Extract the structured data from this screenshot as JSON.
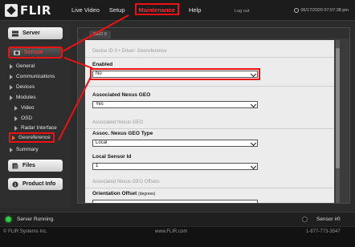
{
  "header": {
    "logo_text": "FLIR",
    "nav": [
      "Live Video",
      "Setup",
      "Maintenance",
      "Help"
    ],
    "logout": "Log out",
    "datetime": "06/17/2020 07:07:38 pm"
  },
  "sidebar": {
    "server": "Server",
    "sensor": "Sensor",
    "items": [
      "General",
      "Communications",
      "Devices",
      "Modules",
      "Video",
      "OSD",
      "Radar Interface",
      "Georeference",
      "Summary"
    ],
    "files": "Files",
    "product_info": "Product Info"
  },
  "panel": {
    "tab": "GEO 0",
    "section1": "Device ID 0  •  Driver: Georeference",
    "enabled_label": "Enabled",
    "enabled_value": "No",
    "assoc_geo_label": "Associated Nexus GEO",
    "assoc_geo_value": "Yes",
    "section2": "Associated Nexus GEO",
    "type_label": "Assoc. Nexus GEO Type",
    "type_value": "Local",
    "sensor_id_label": "Local Sensor Id",
    "sensor_id_value": "1",
    "section3": "Associated Nexus GEO Offsets",
    "orientation_label": "Orientation Offset",
    "orientation_unit": "(degrees)"
  },
  "status": {
    "server": "Server Running.",
    "sensor": "Sensor #0"
  },
  "footer": {
    "copyright": "© FLIR Systems Inc.",
    "url": "www.FLIR.com",
    "phone": "1-877-773-3547"
  },
  "colors": {
    "highlight": "#ee1111",
    "accent_orange": "#ff6a00"
  }
}
